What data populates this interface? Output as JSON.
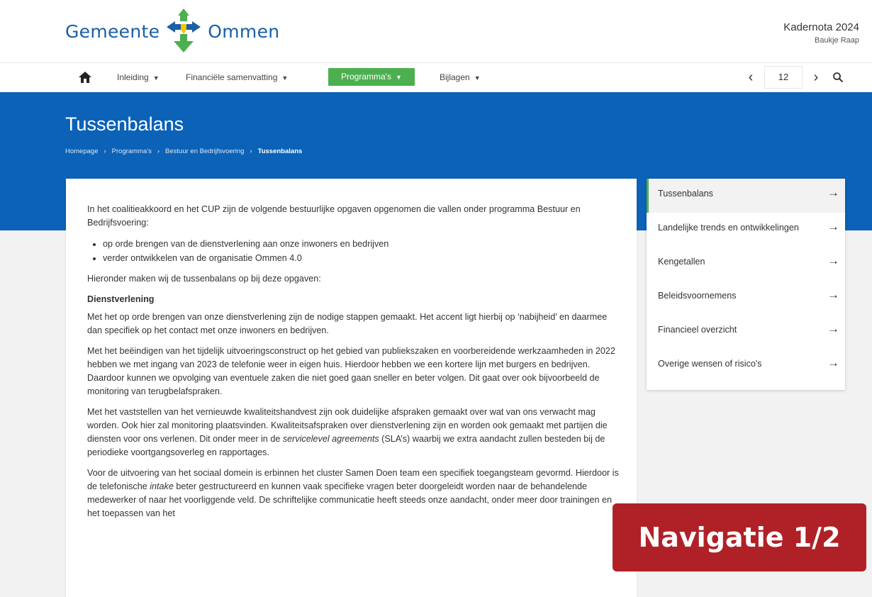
{
  "header": {
    "logo_left": "Gemeente",
    "logo_right": "Ommen",
    "doc_title": "Kadernota 2024",
    "doc_author": "Baukje Raap"
  },
  "nav": {
    "items": [
      {
        "label": "Inleiding"
      },
      {
        "label": "Financiële samenvatting"
      },
      {
        "label": "Programma's"
      },
      {
        "label": "Bijlagen"
      }
    ],
    "active_color": "#4caf50",
    "page_number": "12"
  },
  "banner": {
    "title": "Tussenbalans",
    "breadcrumb": [
      "Homepage",
      "Programma's",
      "Bestuur en Bedrijfsvoering",
      "Tussenbalans"
    ],
    "color": "#0b62b7"
  },
  "content": {
    "intro": "In het coalitieakkoord en het CUP zijn de volgende bestuurlijke opgaven opgenomen die vallen onder programma Bestuur en Bedrijfsvoering:",
    "bullets": [
      "op orde brengen van de dienstverlening aan onze inwoners en bedrijven",
      "verder ontwikkelen van de organisatie Ommen 4.0"
    ],
    "p2": "Hieronder maken wij de tussenbalans op bij deze opgaven:",
    "heading": "Dienstverlening",
    "p3": "Met het op orde brengen van onze dienstverlening zijn de nodige stappen gemaakt. Het accent ligt hierbij op ‘nabijheid’ en daarmee dan specifiek op het contact met onze inwoners en bedrijven.",
    "p4": "Met het beëindigen van het tijdelijk uitvoeringsconstruct op het gebied van publiekszaken en voorbereidende werkzaamheden in 2022 hebben we met ingang van 2023 de telefonie weer in eigen huis. Hierdoor hebben we een kortere lijn met burgers en bedrijven. Daardoor kunnen we opvolging van eventuele zaken die niet goed gaan sneller en beter volgen. Dit gaat over ook bijvoorbeeld de monitoring van terugbelafspraken.",
    "p5_a": "Met het vaststellen van het vernieuwde kwaliteitshandvest zijn ook duidelijke afspraken gemaakt over wat van ons verwacht mag worden. Ook hier zal monitoring plaatsvinden. Kwaliteitsafspraken over dienstverlening zijn en worden ook gemaakt met partijen die diensten voor ons verlenen. Dit onder meer in de ",
    "p5_em": "servicelevel agreements",
    "p5_b": " (SLA’s) waarbij we extra aandacht zullen besteden bij de periodieke voortgangsoverleg en rapportages.",
    "p6_a": "Voor de uitvoering van het sociaal domein is erbinnen het cluster Samen Doen team een specifiek toegangsteam gevormd. Hierdoor is de telefonische ",
    "p6_em": "intake",
    "p6_b": " beter gestructureerd en kunnen vaak specifieke vragen beter doorgeleidt worden naar de behandelende medewerker of naar het voorliggende veld. De schriftelijke communicatie heeft steeds onze aandacht, onder meer door trainingen en het toepassen van het"
  },
  "side_nav": {
    "items": [
      {
        "label": "Tussenbalans"
      },
      {
        "label": "Landelijke trends en ontwikkelingen"
      },
      {
        "label": "Kengetallen"
      },
      {
        "label": "Beleidsvoornemens"
      },
      {
        "label": "Financieel overzicht"
      },
      {
        "label": "Overige wensen of risico's"
      }
    ]
  },
  "overlay": {
    "label": "Navigatie 1/2",
    "color": "#b02127"
  }
}
